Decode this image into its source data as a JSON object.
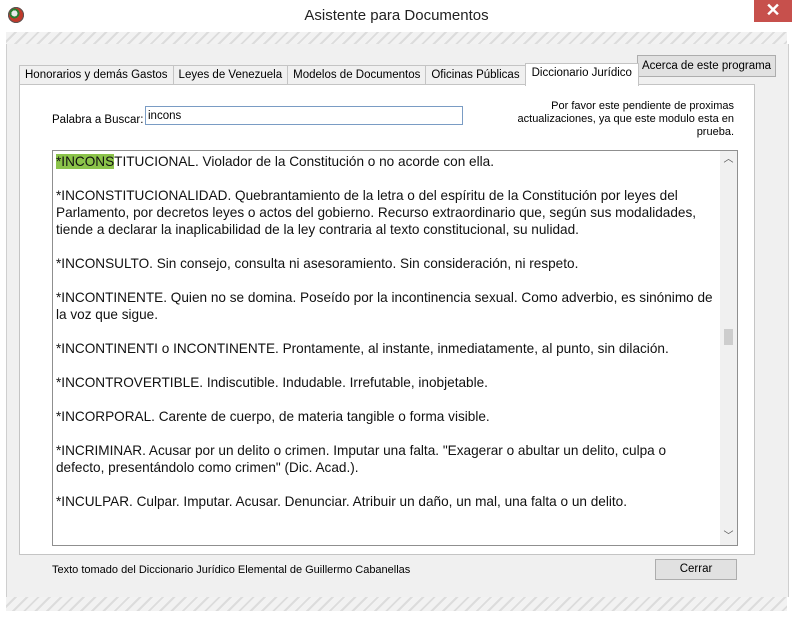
{
  "window": {
    "title": "Asistente para Documentos",
    "close_glyph": "✕"
  },
  "tabs": [
    {
      "label": "Honorarios y demás Gastos"
    },
    {
      "label": "Leyes de Venezuela"
    },
    {
      "label": "Modelos de Documentos"
    },
    {
      "label": "Oficinas Públicas"
    },
    {
      "label": "Diccionario Jurídico"
    }
  ],
  "active_tab_index": 4,
  "about_button": {
    "label": "Acerca de este programa"
  },
  "search": {
    "label": "Palabra a Buscar:",
    "value": "incons"
  },
  "notice": {
    "text": "Por favor este pendiente de proximas actualizaciones, ya que este modulo esta en prueba."
  },
  "results": {
    "highlight_color": "#8bc34a",
    "entries": [
      {
        "highlight": "*INCONS",
        "rest": "TITUCIONAL. Violador de la Constitución o no acorde con ella."
      },
      {
        "highlight": "",
        "rest": "*INCONSTITUCIONALIDAD. Quebrantamiento de la letra o del espíritu de la Constitución por leyes del Parlamento, por decretos leyes o actos del gobierno. Recurso extraordinario que, según sus modalidades, tiende a declarar la inaplicabilidad de la ley contraria al texto constitucional, su nulidad."
      },
      {
        "highlight": "",
        "rest": "*INCONSULTO. Sin consejo, consulta ni asesoramiento. Sin consideración, ni respeto."
      },
      {
        "highlight": "",
        "rest": "*INCONTINENTE. Quien no se domina. Poseído por la incontinencia sexual. Como adverbio, es sinónimo de la voz que sigue."
      },
      {
        "highlight": "",
        "rest": "*INCONTINENTI o INCONTINENTE. Prontamente, al instante, inmediatamente, al punto, sin dilación."
      },
      {
        "highlight": "",
        "rest": "*INCONTROVERTIBLE. Indiscutible. Indudable. Irrefutable, inobjetable."
      },
      {
        "highlight": "",
        "rest": "*INCORPORAL. Carente de cuerpo, de materia tangible o forma visible."
      },
      {
        "highlight": "",
        "rest": "*INCRIMINAR. Acusar por un delito o crimen. Imputar una falta. \"Exagerar o abultar un delito, culpa o defecto, presentándolo como crimen\" (Dic. Acad.)."
      },
      {
        "highlight": "",
        "rest": "*INCULPAR. Culpar. Imputar. Acusar. Denunciar. Atribuir un daño, un mal, una falta o un delito."
      }
    ]
  },
  "scrollbar": {
    "up_icon": "chevron-up-icon",
    "down_icon": "chevron-down-icon",
    "up_glyph": "︿",
    "down_glyph": "﹀"
  },
  "footer": {
    "source_text": "Texto tomado del Diccionario Jurídico Elemental de Guillermo Cabanellas"
  },
  "close_button": {
    "label": "Cerrar"
  }
}
